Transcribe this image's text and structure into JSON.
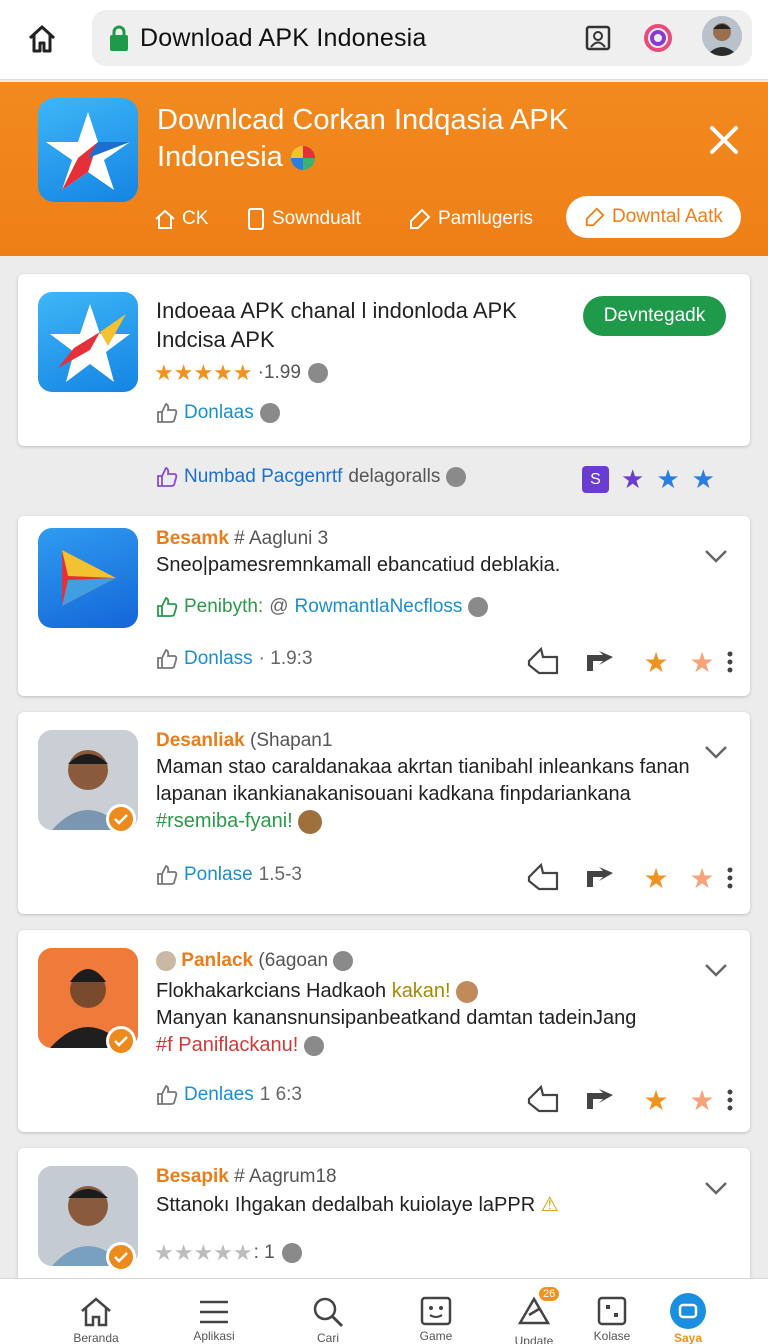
{
  "browser": {
    "url_title": "Download  APK Indonesia"
  },
  "banner": {
    "title": "Downlcad Corkan Indqasia APK Indonesia",
    "tabs": [
      {
        "label": "CK"
      },
      {
        "label": "Sowndualt"
      },
      {
        "label": "Pamlugeris"
      },
      {
        "label": "Downtal Aatk"
      }
    ]
  },
  "app_card": {
    "title_line1": "Indoeaa APK chanal l indonloda APK",
    "title_line2": "Indcisa APK",
    "rating": "·1.99",
    "download_button": "Devntegadk",
    "likes_label": "Donlaas"
  },
  "info_row": {
    "label": "Numbad Pacgenrtf",
    "suffix": "delagoralls"
  },
  "posts": [
    {
      "name": "Besamk",
      "tag": "# Aagluni 3",
      "line1": "Sneo|pamesremnkamall ebancatiud deblakia.",
      "meta_green": "Penibyth:",
      "meta_blue": "RowmantlaNecfloss",
      "likes_label": "Donlass",
      "count": "· 1.9:3"
    },
    {
      "name": "Desanliak",
      "tag": "(Shapan1",
      "line1": "Maman stao caraldanakaa akrtan  tianibahl inleankans fanan",
      "line2": "lapanan ikankianakanisouani kadkana finpdariankana",
      "hashtag": "#rsemiba-fyani!",
      "likes_label": "Ponlase",
      "count": "1.5-3"
    },
    {
      "name": "Panlack",
      "tag": "(6agoan",
      "line1": "Flokhakarkcians Hadkaoh",
      "line1_yellow": "kakan!",
      "line2": "Manyan kanansnunsipanbeatkand damtan tadeinJang",
      "hashtag": "#f Paniflackanu!",
      "likes_label": "Denlaes",
      "count": "1 6:3"
    },
    {
      "name": "Besapik",
      "tag": "# Aagrum18",
      "line1": "Sttanokı Ihgakan dedalbah kuiolaye laPPR",
      "rating": ": 1"
    }
  ],
  "bottom_nav": [
    {
      "label": "Beranda",
      "icon": "home-icon"
    },
    {
      "label": "Aplikasi",
      "icon": "menu-icon"
    },
    {
      "label": "Cari",
      "icon": "search-icon"
    },
    {
      "label": "Game",
      "icon": "face-box-icon"
    },
    {
      "label": "Update",
      "icon": "notify-icon",
      "badge": "26"
    },
    {
      "label": "Kolase",
      "icon": "grid-icon"
    },
    {
      "label": "Saya",
      "icon": "profile-icon"
    }
  ],
  "colors": {
    "banner_orange": "#ee7f16",
    "accent_green": "#1f9a4a",
    "link_blue": "#1a8fd0",
    "star_orange": "#f2921e",
    "star_blue": "#2a7de1"
  }
}
